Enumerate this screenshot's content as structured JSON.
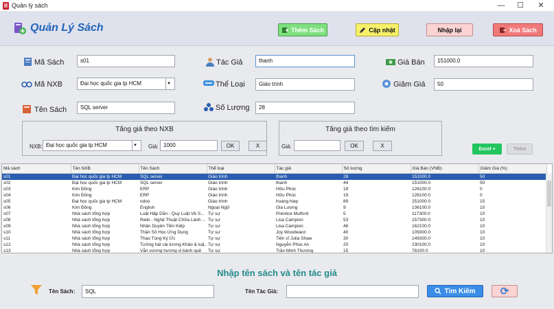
{
  "window": {
    "title": "Quản lý sách",
    "minimize": "—",
    "maximize": "☐",
    "close": "✕"
  },
  "header": {
    "title": "Quản Lý Sách",
    "buttons": {
      "add": "Thêm Sách",
      "update": "Cập nhật",
      "reset": "Nhập lại",
      "delete": "Xoá Sách"
    },
    "colors": {
      "add": "#7ee07e",
      "update": "#f6f06a",
      "reset": "#fbd3d3",
      "delete": "#f07a7a",
      "title": "#1f63b8"
    }
  },
  "form": {
    "ma_sach": {
      "label": "Mã Sách",
      "value": "s01"
    },
    "tac_gia": {
      "label": "Tác Giả",
      "value": "thanh"
    },
    "gia_ban": {
      "label": "Giá Bán",
      "value": "151000.0"
    },
    "ma_nxb": {
      "label": "Mã NXB",
      "value": "Đại học quốc gia tp HCM"
    },
    "the_loai": {
      "label": "Thể Loại",
      "value": "Giáo trình"
    },
    "giam_gia": {
      "label": "Giảm Giá",
      "value": "50"
    },
    "ten_sach": {
      "label": "Tên Sách",
      "value": "SQL server"
    },
    "so_luong": {
      "label": "Số Lượng",
      "value": "28"
    }
  },
  "panel_nxb": {
    "title": "Tăng giá theo NXB",
    "nxb_label": "NXB:",
    "nxb_value": "Đại học quốc gia tp HCM",
    "gia_label": "Giá:",
    "gia_value": "1000",
    "ok": "OK",
    "cancel": "X"
  },
  "panel_search": {
    "title": "Tăng giá theo tìm kiếm",
    "gia_label": "Giá:",
    "gia_value": "",
    "ok": "OK",
    "cancel": "X"
  },
  "excel": {
    "label": "Excel +",
    "color": "#22c55e"
  },
  "import": {
    "label": "Thêm"
  },
  "table": {
    "columns": [
      "Mã sách",
      "Tên NXB",
      "Tên Sách",
      "Thể loại",
      "Tác giả",
      "Số lượng",
      "Giá Bán (VNĐ)",
      "Giảm Giá (%)"
    ],
    "rows": [
      [
        "s01",
        "Đại học quốc gia tp HCM",
        "SQL server",
        "Giáo trình",
        "thanh",
        "28",
        "151000.0",
        "50"
      ],
      [
        "s02",
        "Đại học quốc gia tp HCM",
        "SQL server",
        "Giáo trình",
        "thanh",
        "44",
        "151000.0",
        "50"
      ],
      [
        "s03",
        "Kim Đồng",
        "ERP",
        "Giáo trình",
        "Hữu Phúc",
        "19",
        "126100.0",
        "0"
      ],
      [
        "s04",
        "Kim Đồng",
        "ERP",
        "Giáo trình",
        "Hữu Phúc",
        "19",
        "126100.0",
        "0"
      ],
      [
        "s05",
        "Đại học quốc gia tp HCM",
        "odoo",
        "Giáo trình",
        "hoang hiep",
        "89",
        "251000.0",
        "15"
      ],
      [
        "s06",
        "Kim Đồng",
        "English",
        "Ngoại Ngữ",
        "Gia Lượng",
        "9",
        "136100.0",
        "10"
      ],
      [
        "s07",
        "Nhà sách tổng hợp",
        "Luật Hấp Dẫn - Quy Luật Về S...",
        "Tự sự",
        "Prentice Mulford",
        "5",
        "117300.0",
        "10"
      ],
      [
        "s08",
        "Nhà sách tổng hợp",
        "Reiki - Nghệ Thuật Chữa Lành ...",
        "Tự sự",
        "Lisa Campion",
        "53",
        "157300.0",
        "10"
      ],
      [
        "s09",
        "Nhà sách tổng hợp",
        "Nhân Duyên Tiền Kiếp",
        "Tự sự",
        "Lisa Campion",
        "46",
        "162100.0",
        "10"
      ],
      [
        "s10",
        "Nhà sách tổng hợp",
        "Thần Số Học Ứng Dụng",
        "Tự sự",
        "Joy Woodward",
        "40",
        "109300.0",
        "10"
      ],
      [
        "s11",
        "Nhà sách tổng hợp",
        "Thao Túng Ký Ức",
        "Tự sự",
        "Tiến sĩ Julia Shaw",
        "30",
        "149300.0",
        "10"
      ],
      [
        "s12",
        "Nhà sách tổng hợp",
        "Tưởng hát cải lương Khảo & luậ...",
        "Tự sự",
        "Nguyễn Phúc An",
        "20",
        "230100.0",
        "10"
      ],
      [
        "s13",
        "Nhà sách tổng hợp",
        "Vẫn vương hương vị bánh quê",
        "Tự sự",
        "Trần Minh Thương",
        "15",
        "78100.0",
        "10"
      ]
    ],
    "selected_row": 0
  },
  "search": {
    "heading": "Nhập tên sách và tên tác giả",
    "ten_sach_label": "Tên Sách:",
    "ten_sach_value": "SQL",
    "ten_tac_gia_label": "Tên Tác Giả:",
    "ten_tac_gia_value": "",
    "button": "Tìm Kiếm",
    "refresh": "⟳"
  }
}
